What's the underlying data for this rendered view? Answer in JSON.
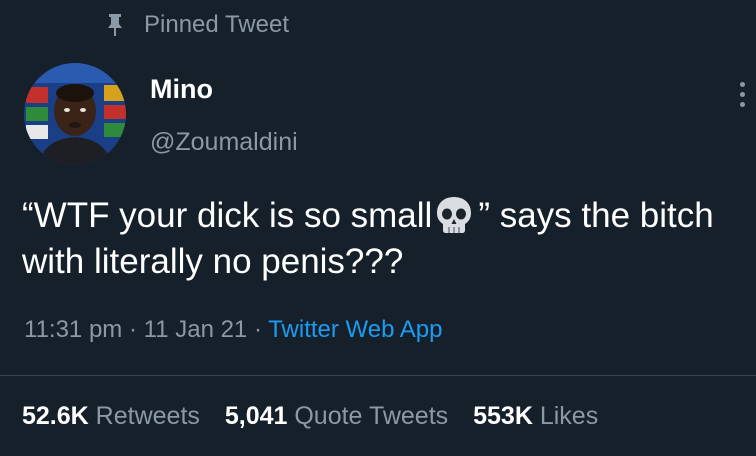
{
  "pinned_label": "Pinned Tweet",
  "author": {
    "display_name": "Mino",
    "handle": "@Zoumaldini"
  },
  "tweet": {
    "text_before_emoji": "“WTF your dick is so small",
    "emoji": "skull-icon",
    "text_after_emoji": "” says the bitch with literally no penis???"
  },
  "meta": {
    "time": "11:31 pm",
    "separator": "·",
    "date": "11 Jan 21",
    "source": "Twitter Web App"
  },
  "stats": {
    "retweets": {
      "count": "52.6K",
      "label": "Retweets"
    },
    "quote_tweets": {
      "count": "5,041",
      "label": "Quote Tweets"
    },
    "likes": {
      "count": "553K",
      "label": "Likes"
    }
  },
  "colors": {
    "background": "#15202b",
    "secondary_text": "#8b98a5",
    "link": "#1d9bf0",
    "divider": "#38444d"
  }
}
